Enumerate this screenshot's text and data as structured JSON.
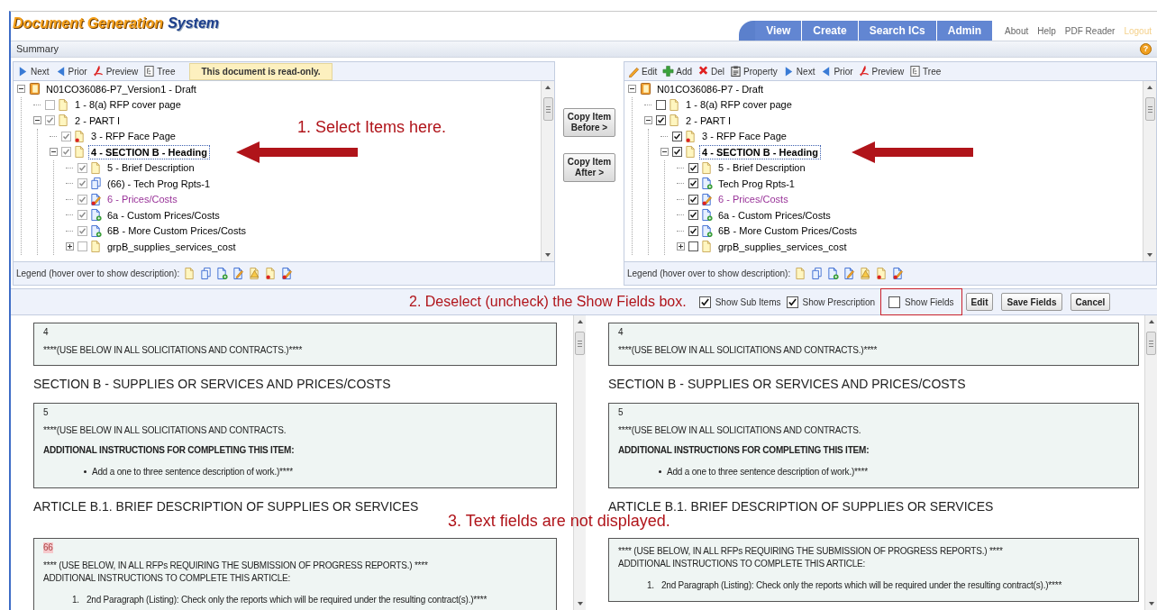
{
  "header": {
    "logo": {
      "primary": "Document Generation",
      "secondary": "System"
    },
    "nav_tabs": [
      {
        "label": "View"
      },
      {
        "label": "Create"
      },
      {
        "label": "Search ICs"
      },
      {
        "label": "Admin"
      }
    ],
    "links": [
      {
        "label": "About",
        "disabled": false
      },
      {
        "label": "Help",
        "disabled": false
      },
      {
        "label": "PDF Reader",
        "disabled": false
      },
      {
        "label": "Logout",
        "disabled": true
      }
    ]
  },
  "summary_bar": {
    "title": "Summary",
    "help_icon": "?"
  },
  "panels": [
    {
      "toolbar": [
        {
          "kind": "next",
          "label": "Next"
        },
        {
          "kind": "prior",
          "label": "Prior"
        },
        {
          "kind": "preview",
          "label": "Preview"
        },
        {
          "kind": "tree",
          "label": "Tree"
        }
      ],
      "notice": "This document is read-only.",
      "read_only": true,
      "annotation": "1. Select Items here.",
      "pointer_arrow": true,
      "tree": {
        "label": "N01CO36086-P7_Version1 - Draft",
        "kind": "book",
        "expanded": true,
        "selected": false,
        "highlighted": false,
        "children": [
          {
            "label": "1 - 8(a) RFP cover page",
            "kind": "page",
            "checked": false,
            "selected": false,
            "highlighted": false
          },
          {
            "label": "2 - PART I",
            "kind": "page",
            "checked": true,
            "expanded": true,
            "selected": false,
            "highlighted": false,
            "children": [
              {
                "label": "3 - RFP Face Page",
                "kind": "page-alert",
                "checked": true,
                "selected": false,
                "highlighted": false
              },
              {
                "label": "4 - SECTION B - Heading",
                "kind": "page",
                "checked": true,
                "expanded": true,
                "selected": true,
                "highlighted": false,
                "children": [
                  {
                    "label": "5 - Brief Description",
                    "kind": "page",
                    "checked": true,
                    "selected": false,
                    "highlighted": false
                  },
                  {
                    "label": "(66) - Tech Prog Rpts-1",
                    "kind": "pages",
                    "checked": true,
                    "selected": false,
                    "highlighted": false
                  },
                  {
                    "label": "6 - Prices/Costs",
                    "kind": "page-edit-alert",
                    "checked": true,
                    "selected": false,
                    "highlighted": true
                  },
                  {
                    "label": "6a - Custom Prices/Costs",
                    "kind": "page-plus",
                    "checked": true,
                    "selected": false,
                    "highlighted": false
                  },
                  {
                    "label": "6B - More Custom Prices/Costs",
                    "kind": "page-plus",
                    "checked": true,
                    "selected": false,
                    "highlighted": false
                  },
                  {
                    "label": "grpB_supplies_services_cost",
                    "kind": "page",
                    "checked": false,
                    "expanded": false,
                    "selected": false,
                    "highlighted": false
                  }
                ]
              }
            ]
          }
        ]
      },
      "legend": {
        "label": "Legend (hover over to show description):",
        "icons": [
          {
            "kind": "page"
          },
          {
            "kind": "pages"
          },
          {
            "kind": "page-plus"
          },
          {
            "kind": "page-edit"
          },
          {
            "kind": "page-warn"
          },
          {
            "kind": "page-alert"
          },
          {
            "kind": "page-edit-alert"
          }
        ]
      }
    },
    {
      "toolbar": [
        {
          "kind": "edit",
          "label": "Edit"
        },
        {
          "kind": "add",
          "label": "Add"
        },
        {
          "kind": "delete",
          "label": "Del"
        },
        {
          "kind": "property",
          "label": "Property"
        },
        {
          "kind": "next",
          "label": "Next"
        },
        {
          "kind": "prior",
          "label": "Prior"
        },
        {
          "kind": "preview",
          "label": "Preview"
        },
        {
          "kind": "tree",
          "label": "Tree"
        }
      ],
      "read_only": false,
      "pointer_arrow": true,
      "tree": {
        "label": "N01CO36086-P7 - Draft",
        "kind": "book",
        "expanded": true,
        "selected": false,
        "highlighted": false,
        "children": [
          {
            "label": "1 - 8(a) RFP cover page",
            "kind": "page",
            "checked": false,
            "selected": false,
            "highlighted": false
          },
          {
            "label": "2 - PART I",
            "kind": "page",
            "checked": true,
            "expanded": true,
            "selected": false,
            "highlighted": false,
            "children": [
              {
                "label": "3 - RFP Face Page",
                "kind": "page-alert",
                "checked": true,
                "selected": false,
                "highlighted": false
              },
              {
                "label": "4 - SECTION B - Heading",
                "kind": "page",
                "checked": true,
                "expanded": true,
                "selected": true,
                "highlighted": false,
                "children": [
                  {
                    "label": "5 - Brief Description",
                    "kind": "page",
                    "checked": true,
                    "selected": false,
                    "highlighted": false
                  },
                  {
                    "label": "Tech Prog Rpts-1",
                    "kind": "page-plus",
                    "checked": true,
                    "selected": false,
                    "highlighted": false
                  },
                  {
                    "label": "6 - Prices/Costs",
                    "kind": "page-edit-alert",
                    "checked": true,
                    "selected": false,
                    "highlighted": true
                  },
                  {
                    "label": "6a - Custom Prices/Costs",
                    "kind": "page-plus",
                    "checked": true,
                    "selected": false,
                    "highlighted": false
                  },
                  {
                    "label": "6B - More Custom Prices/Costs",
                    "kind": "page-plus",
                    "checked": true,
                    "selected": false,
                    "highlighted": false
                  },
                  {
                    "label": "grpB_supplies_services_cost",
                    "kind": "page",
                    "checked": false,
                    "expanded": false,
                    "selected": false,
                    "highlighted": false
                  }
                ]
              }
            ]
          }
        ]
      },
      "legend": {
        "label": "Legend (hover over to show description):",
        "icons": [
          {
            "kind": "page"
          },
          {
            "kind": "pages"
          },
          {
            "kind": "page-plus"
          },
          {
            "kind": "page-edit"
          },
          {
            "kind": "page-warn"
          },
          {
            "kind": "page-alert"
          },
          {
            "kind": "page-edit-alert"
          }
        ]
      }
    }
  ],
  "copy_buttons": [
    {
      "label": "Copy Item Before >"
    },
    {
      "label": "Copy Item After >"
    }
  ],
  "options_bar": {
    "annotation": "2. Deselect (uncheck) the Show Fields box.",
    "checkboxes": [
      {
        "label": "Show Sub Items",
        "checked": true,
        "outlined": false
      },
      {
        "label": "Show Prescription",
        "checked": true,
        "outlined": false
      },
      {
        "label": "Show Fields",
        "checked": false,
        "outlined": true
      }
    ],
    "buttons": [
      {
        "label": "Edit"
      },
      {
        "label": "Save Fields"
      },
      {
        "label": "Cancel"
      }
    ]
  },
  "previews": [
    {
      "blocks": [
        {
          "kind": "box",
          "number": "4",
          "number_highlighted": false,
          "paragraphs": [
            {
              "kind": "text",
              "text": "****(USE BELOW IN ALL SOLICITATIONS AND CONTRACTS.)****"
            }
          ]
        },
        {
          "kind": "heading",
          "text": "SECTION B - SUPPLIES OR SERVICES AND PRICES/COSTS"
        },
        {
          "kind": "box",
          "number": "5",
          "number_highlighted": false,
          "paragraphs": [
            {
              "kind": "text",
              "text": "****(USE BELOW IN ALL SOLICITATIONS AND CONTRACTS."
            },
            {
              "kind": "bold",
              "text": "ADDITIONAL INSTRUCTIONS FOR COMPLETING THIS ITEM:"
            },
            {
              "kind": "bullet",
              "text": "Add a one to three sentence description of work.)****"
            }
          ]
        },
        {
          "kind": "heading",
          "text": "ARTICLE B.1. BRIEF DESCRIPTION OF SUPPLIES OR SERVICES"
        },
        {
          "kind": "box",
          "number": "66",
          "number_highlighted": true,
          "paragraphs": [
            {
              "kind": "text",
              "text": "**** (USE BELOW, IN ALL RFPs REQUIRING THE SUBMISSION OF PROGRESS REPORTS.) ****"
            },
            {
              "kind": "line",
              "text": "ADDITIONAL INSTRUCTIONS TO COMPLETE THIS ARTICLE:"
            },
            {
              "kind": "numbered",
              "marker": "1.",
              "text": "2nd Paragraph (Listing): Check only the reports which will be required under the resulting contract(s).)****"
            }
          ]
        }
      ]
    },
    {
      "blocks": [
        {
          "kind": "box",
          "number": "4",
          "number_highlighted": false,
          "paragraphs": [
            {
              "kind": "text",
              "text": "****(USE BELOW IN ALL SOLICITATIONS AND CONTRACTS.)****"
            }
          ]
        },
        {
          "kind": "heading",
          "text": "SECTION B - SUPPLIES OR SERVICES AND PRICES/COSTS"
        },
        {
          "kind": "box",
          "number": "5",
          "number_highlighted": false,
          "paragraphs": [
            {
              "kind": "text",
              "text": "****(USE BELOW IN ALL SOLICITATIONS AND CONTRACTS."
            },
            {
              "kind": "bold",
              "text": "ADDITIONAL INSTRUCTIONS FOR COMPLETING THIS ITEM:"
            },
            {
              "kind": "bullet",
              "text": "Add a one to three sentence description of work.)****"
            }
          ]
        },
        {
          "kind": "heading",
          "text": "ARTICLE B.1. BRIEF DESCRIPTION OF SUPPLIES OR SERVICES"
        },
        {
          "kind": "box",
          "paragraphs": [
            {
              "kind": "text",
              "text": "**** (USE BELOW, IN ALL RFPs REQUIRING THE SUBMISSION OF PROGRESS REPORTS.) ****"
            },
            {
              "kind": "line",
              "text": "ADDITIONAL INSTRUCTIONS TO COMPLETE THIS ARTICLE:"
            },
            {
              "kind": "numbered",
              "marker": "1.",
              "text": "2nd Paragraph (Listing): Check only the reports which will be required under the resulting contract(s).)****"
            }
          ]
        }
      ]
    }
  ],
  "preview_annotation": "3. Text fields are not displayed."
}
